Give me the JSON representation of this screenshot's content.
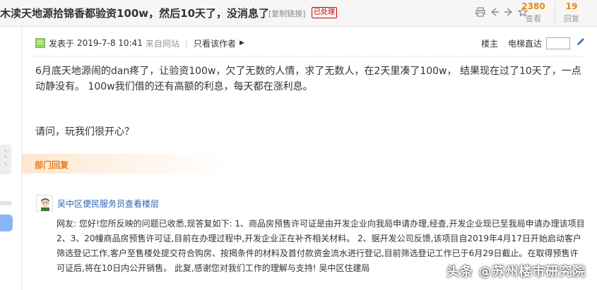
{
  "thread": {
    "title": "木渎天地源拾锦香都验资100w，然后10天了，没消息了",
    "copy_link_label": "[复制链接]",
    "status_badge": "已处理",
    "views_count": "2380",
    "views_label": "查看",
    "replies_count": "19",
    "replies_label": "回复"
  },
  "toolbar": {
    "icons": [
      "print-icon",
      "prev-icon",
      "next-icon",
      "star-icon"
    ]
  },
  "post": {
    "posted_prefix": "发表于",
    "date": "2019-7-8 10:41",
    "source": "来自网站",
    "only_author_label": "只看该作者",
    "floor_label": "楼主",
    "elevator_label": "电梯直达",
    "goto_value": "",
    "content": "6月底天地源闹的dan疼了，让验资100w，欠了无数的人情，求了无数人，在2天里凑了100w， 结果现在过了10天了，一点动静没有。 100w我们借的还有高额的利息，每天都在涨利息。",
    "question": "请问，玩我们很开心？"
  },
  "reply": {
    "section_title": "部门回复",
    "replier": "吴中区便民服务员查看楼层",
    "text": "网友: 您好!您所反映的问题已收悉,现答复如下: 1、商品房预售许可证是由开发企业向我局申请办理,经查,开发企业现已至我局申请办理该项目2、3、20幢商品房预售许可证,目前在办理过程中,开发企业正在补齐相关材料。 2、据开发公司反馈,该项目自2019年4月17日开始启动客户筛选登记工作,客户至售楼处提交符合购房、按揭条件的材料及首付款资金流水进行登记,目前筛选登记工作已于6月29日截止。在取得预售许可证后,将在10日内公开销售。 此复,感谢您对我们工作的理解与支持! 吴中区住建局"
  },
  "watermark": "头条 @苏州楼市研究院",
  "colors": {
    "accent_orange": "#e9890d",
    "badge_red": "#d40000",
    "link_blue": "#2d64b3",
    "dept_orange": "#ea7a1d"
  }
}
